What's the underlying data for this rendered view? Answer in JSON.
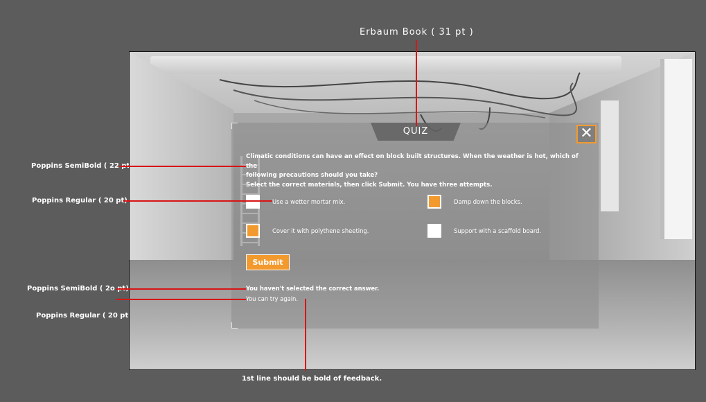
{
  "annotations": {
    "title_font": "Erbaum Book  ( 31 pt )",
    "question_font": "Poppins SemiBold  ( 22 pt)",
    "options_font": "Poppins Regular  ( 20 pt)",
    "feedback_bold_font": "Poppins SemiBold  ( 2o pt)",
    "feedback_regular_font": "Poppins Regular ( 20 pt)",
    "feedback_note": "1st line should be bold of feedback."
  },
  "quiz": {
    "title": "QUIZ",
    "close_symbol": "✕",
    "question_line1": "Climatic conditions can have an effect on block built structures. When the weather is hot, which of the",
    "question_line2": "following precautions should you take?",
    "instruction": "Select the correct materials, then click Submit. You have three attempts.",
    "options": [
      {
        "label": "Use a wetter mortar mix.",
        "selected": false
      },
      {
        "label": "Damp down the blocks.",
        "selected": true
      },
      {
        "label": "Cover it with polythene sheeting.",
        "selected": true
      },
      {
        "label": "Support with a scaffold board.",
        "selected": false
      }
    ],
    "submit_label": "Submit",
    "feedback_line1": "You haven't selected the correct answer.",
    "feedback_line2": "You can try again."
  },
  "colors": {
    "accent": "#f39a2f",
    "annotation_line": "#d81515",
    "page_background": "#5c5c5c"
  }
}
